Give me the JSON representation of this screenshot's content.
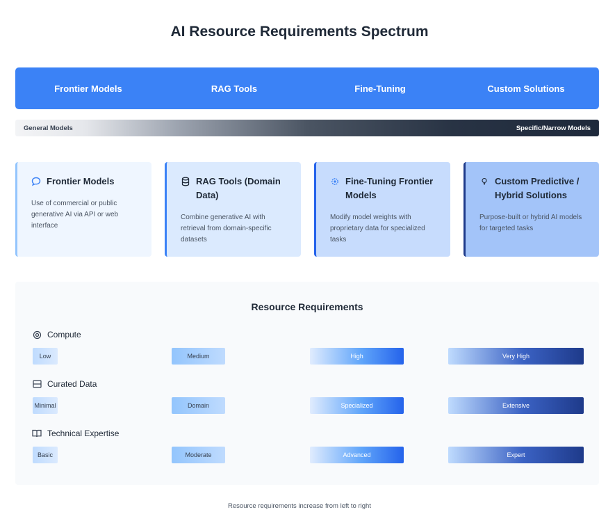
{
  "title": "AI Resource Requirements Spectrum",
  "header_items": [
    "Frontier Models",
    "RAG Tools",
    "Fine-Tuning",
    "Custom Solutions"
  ],
  "spectrum": {
    "left_label": "General Models",
    "right_label": "Specific/Narrow Models"
  },
  "cards": [
    {
      "title": "Frontier Models",
      "icon": "chat-bubble-icon",
      "description": "Use of commercial or public generative AI via API or web interface"
    },
    {
      "title": "RAG Tools (Domain Data)",
      "icon": "database-icon",
      "description": "Combine generative AI with retrieval from domain-specific datasets"
    },
    {
      "title": "Fine-Tuning Frontier Models",
      "icon": "gear-icon",
      "description": "Modify model weights with proprietary data for specialized tasks"
    },
    {
      "title": "Custom Predictive / Hybrid Solutions",
      "icon": "lightbulb-icon",
      "description": "Purpose-built or hybrid AI models for targeted tasks"
    }
  ],
  "resources": {
    "title": "Resource Requirements",
    "categories": [
      {
        "label": "Compute",
        "icon": "cpu-icon",
        "levels": [
          "Low",
          "Medium",
          "High",
          "Very High"
        ]
      },
      {
        "label": "Curated Data",
        "icon": "database-icon",
        "levels": [
          "Minimal",
          "Domain",
          "Specialized",
          "Extensive"
        ]
      },
      {
        "label": "Technical Expertise",
        "icon": "book-icon",
        "levels": [
          "Basic",
          "Moderate",
          "Advanced",
          "Expert"
        ]
      }
    ]
  },
  "footer": "Resource requirements increase from left to right",
  "colors": {
    "primary": "#3b82f6",
    "dark": "#1e3a8a",
    "panel": "#f8fafc"
  }
}
